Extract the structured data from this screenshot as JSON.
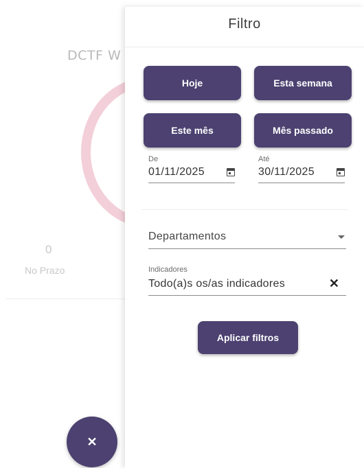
{
  "background": {
    "title": "DCTF W",
    "count": "0",
    "status_label": "No Prazo",
    "close_fab_icon": "close-icon"
  },
  "drawer": {
    "title": "Filtro",
    "quick_filters": [
      "Hoje",
      "Esta semana",
      "Este mês",
      "Mês passado"
    ],
    "date_from": {
      "label": "De",
      "value": "01/11/2025",
      "icon": "calendar-icon"
    },
    "date_to": {
      "label": "Até",
      "value": "30/11/2025",
      "icon": "calendar-icon"
    },
    "departments": {
      "placeholder": "Departamentos"
    },
    "indicators": {
      "label": "Indicadores",
      "value": "Todo(a)s os/as indicadores"
    },
    "apply_label": "Aplicar filtros"
  },
  "colors": {
    "primary": "#4c4170",
    "ring": "#f3cfd9"
  }
}
